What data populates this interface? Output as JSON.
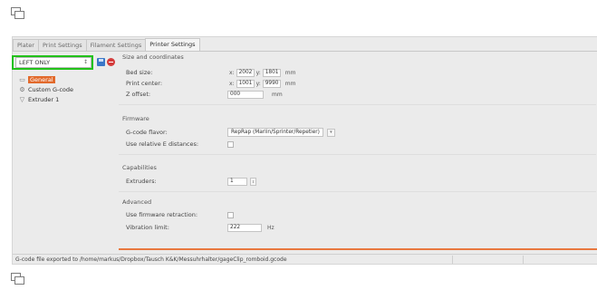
{
  "tabs": [
    {
      "label": "Plater"
    },
    {
      "label": "Print Settings"
    },
    {
      "label": "Filament Settings"
    },
    {
      "label": "Printer Settings",
      "active": true
    }
  ],
  "preset": {
    "value": "LEFT ONLY",
    "arrows": "↕"
  },
  "tree": [
    {
      "label": "General",
      "icon": "printer-icon",
      "selected": true
    },
    {
      "label": "Custom G-code",
      "icon": "gear-icon"
    },
    {
      "label": "Extruder 1",
      "icon": "funnel-icon"
    }
  ],
  "sections": {
    "size": {
      "title": "Size and coordinates",
      "bed_size": {
        "label": "Bed size:",
        "x": "2002",
        "y": "1801",
        "unit": "mm"
      },
      "print_center": {
        "label": "Print center:",
        "x": "1001",
        "y": "9990",
        "unit": "mm"
      },
      "z_offset": {
        "label": "Z offset:",
        "value": "000",
        "unit": "mm"
      },
      "x_label": "x:",
      "y_label": "y:"
    },
    "firmware": {
      "title": "Firmware",
      "gcode_flavor": {
        "label": "G-code flavor:",
        "value": "RepRap (Marlin/Sprinter/Repetier)"
      },
      "relative_e": {
        "label": "Use relative E distances:",
        "checked": false
      }
    },
    "capabilities": {
      "title": "Capabilities",
      "extruders": {
        "label": "Extruders:",
        "value": "1"
      }
    },
    "advanced": {
      "title": "Advanced",
      "firmware_retraction": {
        "label": "Use firmware retraction:",
        "checked": false
      },
      "vibration_limit": {
        "label": "Vibration limit:",
        "value": "222",
        "unit": "Hz"
      }
    }
  },
  "status": {
    "text": "G-code file exported to /home/markus/Dropbox/Tausch K&K/Messuhrhalter/gageClip_romboid.gcode"
  },
  "colors": {
    "highlight": "#22c21a",
    "selection": "#e26a2c",
    "accent_line": "#e8783f"
  }
}
